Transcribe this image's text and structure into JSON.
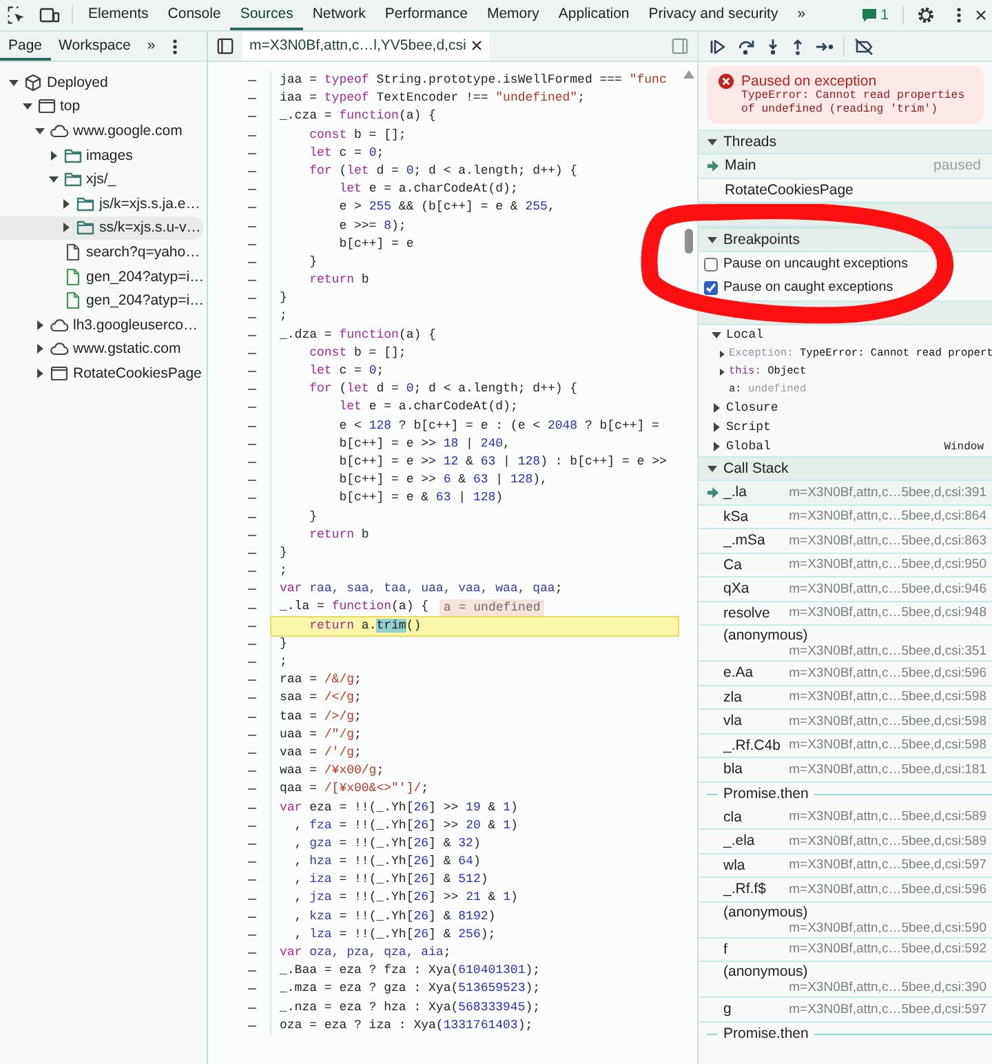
{
  "toolbar": {
    "tabs": [
      {
        "label": "Elements",
        "selected": false
      },
      {
        "label": "Console",
        "selected": false
      },
      {
        "label": "Sources",
        "selected": true
      },
      {
        "label": "Network",
        "selected": false
      },
      {
        "label": "Performance",
        "selected": false
      },
      {
        "label": "Memory",
        "selected": false
      },
      {
        "label": "Application",
        "selected": false
      },
      {
        "label": "Privacy and security",
        "selected": false
      }
    ],
    "overflow": "»",
    "issues_count": "1"
  },
  "navigator": {
    "tabs": [
      {
        "label": "Page",
        "selected": true
      },
      {
        "label": "Workspace",
        "selected": false
      }
    ],
    "overflow": "»",
    "tree": [
      {
        "label": "Deployed",
        "kind": "deployment",
        "expanded": true,
        "selected": false,
        "children": [
          {
            "label": "top",
            "kind": "frame",
            "expanded": true,
            "selected": false,
            "children": [
              {
                "label": "www.google.com",
                "kind": "domain",
                "expanded": true,
                "selected": false,
                "children": [
                  {
                    "label": "images",
                    "kind": "folder",
                    "expanded": false,
                    "selected": false
                  },
                  {
                    "label": "xjs/_",
                    "kind": "folder",
                    "expanded": true,
                    "selected": false,
                    "children": [
                      {
                        "label": "js/k=xjs.s.ja.e…",
                        "kind": "folder",
                        "expanded": false,
                        "selected": false
                      },
                      {
                        "label": "ss/k=xjs.s.u-v…",
                        "kind": "folder",
                        "expanded": false,
                        "selected": true
                      }
                    ]
                  },
                  {
                    "label": "search?q=yaho…",
                    "kind": "document",
                    "selected": false
                  },
                  {
                    "label": "gen_204?atyp=i…",
                    "kind": "request",
                    "selected": false
                  },
                  {
                    "label": "gen_204?atyp=i…",
                    "kind": "request",
                    "selected": false
                  }
                ]
              },
              {
                "label": "lh3.googleuserco…",
                "kind": "domain",
                "expanded": false,
                "selected": false
              },
              {
                "label": "www.gstatic.com",
                "kind": "domain",
                "expanded": false,
                "selected": false
              },
              {
                "label": "RotateCookiesPage",
                "kind": "frame",
                "expanded": false,
                "selected": false
              }
            ]
          }
        ]
      }
    ]
  },
  "editor": {
    "file_tab": {
      "label": "m=X3N0Bf,attn,c…l,YV5bee,d,csi",
      "selected": true
    },
    "lines": [
      {
        "paused": false,
        "code": [
          {
            "kind": "p",
            "text": "jaa = "
          },
          {
            "kind": "kw",
            "text": "typeof"
          },
          {
            "kind": "p",
            "text": " String.prototype.isWellFormed === "
          },
          {
            "kind": "str",
            "text": "\"func"
          }
        ]
      },
      {
        "paused": false,
        "code": [
          {
            "kind": "p",
            "text": "iaa = "
          },
          {
            "kind": "kw",
            "text": "typeof"
          },
          {
            "kind": "p",
            "text": " TextEncoder !== "
          },
          {
            "kind": "str",
            "text": "\"undefined\""
          },
          {
            "kind": "p",
            "text": ";"
          }
        ]
      },
      {
        "paused": false,
        "code": [
          {
            "kind": "p",
            "text": "_.cza = "
          },
          {
            "kind": "kw",
            "text": "function"
          },
          {
            "kind": "p",
            "text": "(a) {"
          }
        ]
      },
      {
        "paused": false,
        "code": [
          {
            "kind": "kw",
            "text": "    const"
          },
          {
            "kind": "p",
            "text": " b = [];"
          }
        ]
      },
      {
        "paused": false,
        "code": [
          {
            "kind": "kw",
            "text": "    let"
          },
          {
            "kind": "p",
            "text": " c = "
          },
          {
            "kind": "num",
            "text": "0"
          },
          {
            "kind": "p",
            "text": ";"
          }
        ]
      },
      {
        "paused": false,
        "code": [
          {
            "kind": "kw",
            "text": "    for"
          },
          {
            "kind": "p",
            "text": " ("
          },
          {
            "kind": "kw",
            "text": "let"
          },
          {
            "kind": "p",
            "text": " d = "
          },
          {
            "kind": "num",
            "text": "0"
          },
          {
            "kind": "p",
            "text": "; d < a.length; d++) {"
          }
        ]
      },
      {
        "paused": false,
        "code": [
          {
            "kind": "kw",
            "text": "        let"
          },
          {
            "kind": "p",
            "text": " e = a.charCodeAt(d);"
          }
        ]
      },
      {
        "paused": false,
        "code": [
          {
            "kind": "p",
            "text": "        e > "
          },
          {
            "kind": "num",
            "text": "255"
          },
          {
            "kind": "p",
            "text": " && (b[c++] = e & "
          },
          {
            "kind": "num",
            "text": "255"
          },
          {
            "kind": "p",
            "text": ","
          }
        ]
      },
      {
        "paused": false,
        "code": [
          {
            "kind": "p",
            "text": "        e >>= "
          },
          {
            "kind": "num",
            "text": "8"
          },
          {
            "kind": "p",
            "text": ");"
          }
        ]
      },
      {
        "paused": false,
        "code": [
          {
            "kind": "p",
            "text": "        b[c++] = e"
          }
        ]
      },
      {
        "paused": false,
        "code": [
          {
            "kind": "p",
            "text": "    }"
          }
        ]
      },
      {
        "paused": false,
        "code": [
          {
            "kind": "kw",
            "text": "    return"
          },
          {
            "kind": "p",
            "text": " b"
          }
        ]
      },
      {
        "paused": false,
        "code": [
          {
            "kind": "p",
            "text": "}"
          }
        ]
      },
      {
        "paused": false,
        "code": [
          {
            "kind": "p",
            "text": ";"
          }
        ]
      },
      {
        "paused": false,
        "code": [
          {
            "kind": "p",
            "text": "_.dza = "
          },
          {
            "kind": "kw",
            "text": "function"
          },
          {
            "kind": "p",
            "text": "(a) {"
          }
        ]
      },
      {
        "paused": false,
        "code": [
          {
            "kind": "kw",
            "text": "    const"
          },
          {
            "kind": "p",
            "text": " b = [];"
          }
        ]
      },
      {
        "paused": false,
        "code": [
          {
            "kind": "kw",
            "text": "    let"
          },
          {
            "kind": "p",
            "text": " c = "
          },
          {
            "kind": "num",
            "text": "0"
          },
          {
            "kind": "p",
            "text": ";"
          }
        ]
      },
      {
        "paused": false,
        "code": [
          {
            "kind": "kw",
            "text": "    for"
          },
          {
            "kind": "p",
            "text": " ("
          },
          {
            "kind": "kw",
            "text": "let"
          },
          {
            "kind": "p",
            "text": " d = "
          },
          {
            "kind": "num",
            "text": "0"
          },
          {
            "kind": "p",
            "text": "; d < a.length; d++) {"
          }
        ]
      },
      {
        "paused": false,
        "code": [
          {
            "kind": "kw",
            "text": "        let"
          },
          {
            "kind": "p",
            "text": " e = a.charCodeAt(d);"
          }
        ]
      },
      {
        "paused": false,
        "code": [
          {
            "kind": "p",
            "text": "        e < "
          },
          {
            "kind": "num",
            "text": "128"
          },
          {
            "kind": "p",
            "text": " ? b[c++] = e : (e < "
          },
          {
            "kind": "num",
            "text": "2048"
          },
          {
            "kind": "p",
            "text": " ? b[c++] ="
          }
        ]
      },
      {
        "paused": false,
        "code": [
          {
            "kind": "p",
            "text": "        b[c++] = e >> "
          },
          {
            "kind": "num",
            "text": "18"
          },
          {
            "kind": "p",
            "text": " | "
          },
          {
            "kind": "num",
            "text": "240"
          },
          {
            "kind": "p",
            "text": ","
          }
        ]
      },
      {
        "paused": false,
        "code": [
          {
            "kind": "p",
            "text": "        b[c++] = e >> "
          },
          {
            "kind": "num",
            "text": "12"
          },
          {
            "kind": "p",
            "text": " & "
          },
          {
            "kind": "num",
            "text": "63"
          },
          {
            "kind": "p",
            "text": " | "
          },
          {
            "kind": "num",
            "text": "128"
          },
          {
            "kind": "p",
            "text": ") : b[c++] = e >>"
          }
        ]
      },
      {
        "paused": false,
        "code": [
          {
            "kind": "p",
            "text": "        b[c++] = e >> "
          },
          {
            "kind": "num",
            "text": "6"
          },
          {
            "kind": "p",
            "text": " & "
          },
          {
            "kind": "num",
            "text": "63"
          },
          {
            "kind": "p",
            "text": " | "
          },
          {
            "kind": "num",
            "text": "128"
          },
          {
            "kind": "p",
            "text": "),"
          }
        ]
      },
      {
        "paused": false,
        "code": [
          {
            "kind": "p",
            "text": "        b[c++] = e & "
          },
          {
            "kind": "num",
            "text": "63"
          },
          {
            "kind": "p",
            "text": " | "
          },
          {
            "kind": "num",
            "text": "128"
          },
          {
            "kind": "p",
            "text": ")"
          }
        ]
      },
      {
        "paused": false,
        "code": [
          {
            "kind": "p",
            "text": "    }"
          }
        ]
      },
      {
        "paused": false,
        "code": [
          {
            "kind": "kw",
            "text": "    return"
          },
          {
            "kind": "p",
            "text": " b"
          }
        ]
      },
      {
        "paused": false,
        "code": [
          {
            "kind": "p",
            "text": "}"
          }
        ]
      },
      {
        "paused": false,
        "code": [
          {
            "kind": "p",
            "text": ";"
          }
        ]
      },
      {
        "paused": false,
        "code": [
          {
            "kind": "kw",
            "text": "var"
          },
          {
            "kind": "def",
            "text": " raa, saa, taa, uaa, vaa, waa, qaa"
          },
          {
            "kind": "p",
            "text": ";"
          }
        ]
      },
      {
        "paused": false,
        "code": [
          {
            "kind": "p",
            "text": "_.la = "
          },
          {
            "kind": "kw",
            "text": "function"
          },
          {
            "kind": "p",
            "text": "(a) {"
          }
        ],
        "inline_value": "a = undefined"
      },
      {
        "paused": true,
        "code": [
          {
            "kind": "kw",
            "text": "    return"
          },
          {
            "kind": "p",
            "text": " a."
          },
          {
            "kind": "hl",
            "text": "trim"
          },
          {
            "kind": "p",
            "text": "()"
          }
        ]
      },
      {
        "paused": false,
        "code": [
          {
            "kind": "p",
            "text": "}"
          }
        ]
      },
      {
        "paused": false,
        "code": [
          {
            "kind": "p",
            "text": ";"
          }
        ]
      },
      {
        "paused": false,
        "code": [
          {
            "kind": "p",
            "text": "raa = "
          },
          {
            "kind": "re",
            "text": "/&/g"
          },
          {
            "kind": "p",
            "text": ";"
          }
        ]
      },
      {
        "paused": false,
        "code": [
          {
            "kind": "p",
            "text": "saa = "
          },
          {
            "kind": "re",
            "text": "/</g"
          },
          {
            "kind": "p",
            "text": ";"
          }
        ]
      },
      {
        "paused": false,
        "code": [
          {
            "kind": "p",
            "text": "taa = "
          },
          {
            "kind": "re",
            "text": "/>/g"
          },
          {
            "kind": "p",
            "text": ";"
          }
        ]
      },
      {
        "paused": false,
        "code": [
          {
            "kind": "p",
            "text": "uaa = "
          },
          {
            "kind": "re",
            "text": "/\"/g"
          },
          {
            "kind": "p",
            "text": ";"
          }
        ]
      },
      {
        "paused": false,
        "code": [
          {
            "kind": "p",
            "text": "vaa = "
          },
          {
            "kind": "re",
            "text": "/'/g"
          },
          {
            "kind": "p",
            "text": ";"
          }
        ]
      },
      {
        "paused": false,
        "code": [
          {
            "kind": "p",
            "text": "waa = "
          },
          {
            "kind": "re",
            "text": "/¥x00/g"
          },
          {
            "kind": "p",
            "text": ";"
          }
        ]
      },
      {
        "paused": false,
        "code": [
          {
            "kind": "p",
            "text": "qaa = "
          },
          {
            "kind": "re",
            "text": "/[¥x00&<>\"']/"
          },
          {
            "kind": "p",
            "text": ";"
          }
        ]
      },
      {
        "paused": false,
        "code": [
          {
            "kind": "kw",
            "text": "var"
          },
          {
            "kind": "p",
            "text": " eza = !!(_.Yh["
          },
          {
            "kind": "num",
            "text": "26"
          },
          {
            "kind": "p",
            "text": "] >> "
          },
          {
            "kind": "num",
            "text": "19"
          },
          {
            "kind": "p",
            "text": " & "
          },
          {
            "kind": "num",
            "text": "1"
          },
          {
            "kind": "p",
            "text": ")"
          }
        ]
      },
      {
        "paused": false,
        "code": [
          {
            "kind": "p",
            "text": "  , "
          },
          {
            "kind": "def",
            "text": "fza"
          },
          {
            "kind": "p",
            "text": " = !!(_.Yh["
          },
          {
            "kind": "num",
            "text": "26"
          },
          {
            "kind": "p",
            "text": "] >> "
          },
          {
            "kind": "num",
            "text": "20"
          },
          {
            "kind": "p",
            "text": " & "
          },
          {
            "kind": "num",
            "text": "1"
          },
          {
            "kind": "p",
            "text": ")"
          }
        ]
      },
      {
        "paused": false,
        "code": [
          {
            "kind": "p",
            "text": "  , "
          },
          {
            "kind": "def",
            "text": "gza"
          },
          {
            "kind": "p",
            "text": " = !!(_.Yh["
          },
          {
            "kind": "num",
            "text": "26"
          },
          {
            "kind": "p",
            "text": "] & "
          },
          {
            "kind": "num",
            "text": "32"
          },
          {
            "kind": "p",
            "text": ")"
          }
        ]
      },
      {
        "paused": false,
        "code": [
          {
            "kind": "p",
            "text": "  , "
          },
          {
            "kind": "def",
            "text": "hza"
          },
          {
            "kind": "p",
            "text": " = !!(_.Yh["
          },
          {
            "kind": "num",
            "text": "26"
          },
          {
            "kind": "p",
            "text": "] & "
          },
          {
            "kind": "num",
            "text": "64"
          },
          {
            "kind": "p",
            "text": ")"
          }
        ]
      },
      {
        "paused": false,
        "code": [
          {
            "kind": "p",
            "text": "  , "
          },
          {
            "kind": "def",
            "text": "iza"
          },
          {
            "kind": "p",
            "text": " = !!(_.Yh["
          },
          {
            "kind": "num",
            "text": "26"
          },
          {
            "kind": "p",
            "text": "] & "
          },
          {
            "kind": "num",
            "text": "512"
          },
          {
            "kind": "p",
            "text": ")"
          }
        ]
      },
      {
        "paused": false,
        "code": [
          {
            "kind": "p",
            "text": "  , "
          },
          {
            "kind": "def",
            "text": "jza"
          },
          {
            "kind": "p",
            "text": " = !!(_.Yh["
          },
          {
            "kind": "num",
            "text": "26"
          },
          {
            "kind": "p",
            "text": "] >> "
          },
          {
            "kind": "num",
            "text": "21"
          },
          {
            "kind": "p",
            "text": " & "
          },
          {
            "kind": "num",
            "text": "1"
          },
          {
            "kind": "p",
            "text": ")"
          }
        ]
      },
      {
        "paused": false,
        "code": [
          {
            "kind": "p",
            "text": "  , "
          },
          {
            "kind": "def",
            "text": "kza"
          },
          {
            "kind": "p",
            "text": " = !!(_.Yh["
          },
          {
            "kind": "num",
            "text": "26"
          },
          {
            "kind": "p",
            "text": "] & "
          },
          {
            "kind": "num",
            "text": "8192"
          },
          {
            "kind": "p",
            "text": ")"
          }
        ]
      },
      {
        "paused": false,
        "code": [
          {
            "kind": "p",
            "text": "  , "
          },
          {
            "kind": "def",
            "text": "lza"
          },
          {
            "kind": "p",
            "text": " = !!(_.Yh["
          },
          {
            "kind": "num",
            "text": "26"
          },
          {
            "kind": "p",
            "text": "] & "
          },
          {
            "kind": "num",
            "text": "256"
          },
          {
            "kind": "p",
            "text": ");"
          }
        ]
      },
      {
        "paused": false,
        "code": [
          {
            "kind": "kw",
            "text": "var"
          },
          {
            "kind": "def",
            "text": " oza, pza, qza, aia"
          },
          {
            "kind": "p",
            "text": ";"
          }
        ]
      },
      {
        "paused": false,
        "code": [
          {
            "kind": "p",
            "text": "_.Baa = eza ? fza : Xya("
          },
          {
            "kind": "num",
            "text": "610401301"
          },
          {
            "kind": "p",
            "text": ");"
          }
        ]
      },
      {
        "paused": false,
        "code": [
          {
            "kind": "p",
            "text": "_.mza = eza ? gza : Xya("
          },
          {
            "kind": "num",
            "text": "513659523"
          },
          {
            "kind": "p",
            "text": ");"
          }
        ]
      },
      {
        "paused": false,
        "code": [
          {
            "kind": "p",
            "text": "_.nza = eza ? hza : Xya("
          },
          {
            "kind": "num",
            "text": "568333945"
          },
          {
            "kind": "p",
            "text": ");"
          }
        ]
      },
      {
        "paused": false,
        "code": [
          {
            "kind": "p",
            "text": "oza = eza ? iza : Xya("
          },
          {
            "kind": "num",
            "text": "1331761403"
          },
          {
            "kind": "p",
            "text": ");"
          }
        ]
      }
    ]
  },
  "debugger": {
    "banner": {
      "title": "Paused on exception",
      "message": "TypeError: Cannot read properties of undefined (reading 'trim')"
    },
    "sections": [
      {
        "kind": "threads",
        "title": "Threads",
        "expanded": true,
        "threads": [
          {
            "name": "Main",
            "status": "paused",
            "selected": true
          },
          {
            "name": "RotateCookiesPage",
            "selected": false
          }
        ]
      },
      {
        "kind": "watch"
      },
      {
        "kind": "breakpoints",
        "title": "Breakpoints",
        "expanded": true,
        "options": [
          {
            "label": "Pause on uncaught exceptions",
            "checked": false
          },
          {
            "label": "Pause on caught exceptions",
            "checked": true
          }
        ]
      },
      {
        "kind": "scope",
        "scopes": [
          {
            "name": "Local",
            "expanded": true,
            "children": [
              {
                "key": "Exception:",
                "value": "TypeError: Cannot read propert",
                "kind": "internal",
                "expanded": false,
                "dimmed": false
              },
              {
                "key": "this:",
                "value": "Object",
                "kind": "property",
                "expanded": false,
                "dimmed": false
              },
              {
                "key": "a:",
                "value": "undefined",
                "kind": "variable",
                "dimmed": true
              }
            ]
          },
          {
            "name": "Closure",
            "expanded": false
          },
          {
            "name": "Script",
            "expanded": false
          },
          {
            "name": "Global",
            "expanded": false,
            "value": "Window"
          }
        ]
      },
      {
        "kind": "callstack",
        "title": "Call Stack",
        "expanded": true,
        "frames": [
          {
            "kind": "frame",
            "name": "_.la",
            "location": "m=X3N0Bf,attn,c…5bee,d,csi:391",
            "selected": true
          },
          {
            "kind": "frame",
            "name": "kSa",
            "location": "m=X3N0Bf,attn,c…5bee,d,csi:864",
            "selected": false
          },
          {
            "kind": "frame",
            "name": "_.mSa",
            "location": "m=X3N0Bf,attn,c…5bee,d,csi:863",
            "selected": false
          },
          {
            "kind": "frame",
            "name": "Ca",
            "location": "m=X3N0Bf,attn,c…5bee,d,csi:950",
            "selected": false
          },
          {
            "kind": "frame",
            "name": "qXa",
            "location": "m=X3N0Bf,attn,c…5bee,d,csi:946",
            "selected": false
          },
          {
            "kind": "frame",
            "name": "resolve",
            "location": "m=X3N0Bf,attn,c…5bee,d,csi:948",
            "selected": false
          },
          {
            "kind": "frame",
            "name": "(anonymous)",
            "location": "m=X3N0Bf,attn,c…5bee,d,csi:351",
            "selected": false
          },
          {
            "kind": "frame",
            "name": "e.Aa",
            "location": "m=X3N0Bf,attn,c…5bee,d,csi:596",
            "selected": false
          },
          {
            "kind": "frame",
            "name": "zla",
            "location": "m=X3N0Bf,attn,c…5bee,d,csi:598",
            "selected": false
          },
          {
            "kind": "frame",
            "name": "vla",
            "location": "m=X3N0Bf,attn,c…5bee,d,csi:598",
            "selected": false
          },
          {
            "kind": "frame",
            "name": "_.Rf.C4b",
            "location": "m=X3N0Bf,attn,c…5bee,d,csi:598",
            "selected": false
          },
          {
            "kind": "frame",
            "name": "bla",
            "location": "m=X3N0Bf,attn,c…5bee,d,csi:181",
            "selected": false
          },
          {
            "kind": "async",
            "name": "Promise.then"
          },
          {
            "kind": "frame",
            "name": "cla",
            "location": "m=X3N0Bf,attn,c…5bee,d,csi:589",
            "selected": false
          },
          {
            "kind": "frame",
            "name": "_.ela",
            "location": "m=X3N0Bf,attn,c…5bee,d,csi:589",
            "selected": false
          },
          {
            "kind": "frame",
            "name": "wla",
            "location": "m=X3N0Bf,attn,c…5bee,d,csi:597",
            "selected": false
          },
          {
            "kind": "frame",
            "name": "_.Rf.f$",
            "location": "m=X3N0Bf,attn,c…5bee,d,csi:596",
            "selected": false
          },
          {
            "kind": "frame",
            "name": "(anonymous)",
            "location": "m=X3N0Bf,attn,c…5bee,d,csi:590",
            "selected": false
          },
          {
            "kind": "frame",
            "name": "f",
            "location": "m=X3N0Bf,attn,c…5bee,d,csi:592",
            "selected": false
          },
          {
            "kind": "frame",
            "name": "(anonymous)",
            "location": "m=X3N0Bf,attn,c…5bee,d,csi:390",
            "selected": false
          },
          {
            "kind": "frame",
            "name": "g",
            "location": "m=X3N0Bf,attn,c…5bee,d,csi:597",
            "selected": false
          },
          {
            "kind": "async",
            "name": "Promise.then"
          }
        ]
      }
    ]
  }
}
